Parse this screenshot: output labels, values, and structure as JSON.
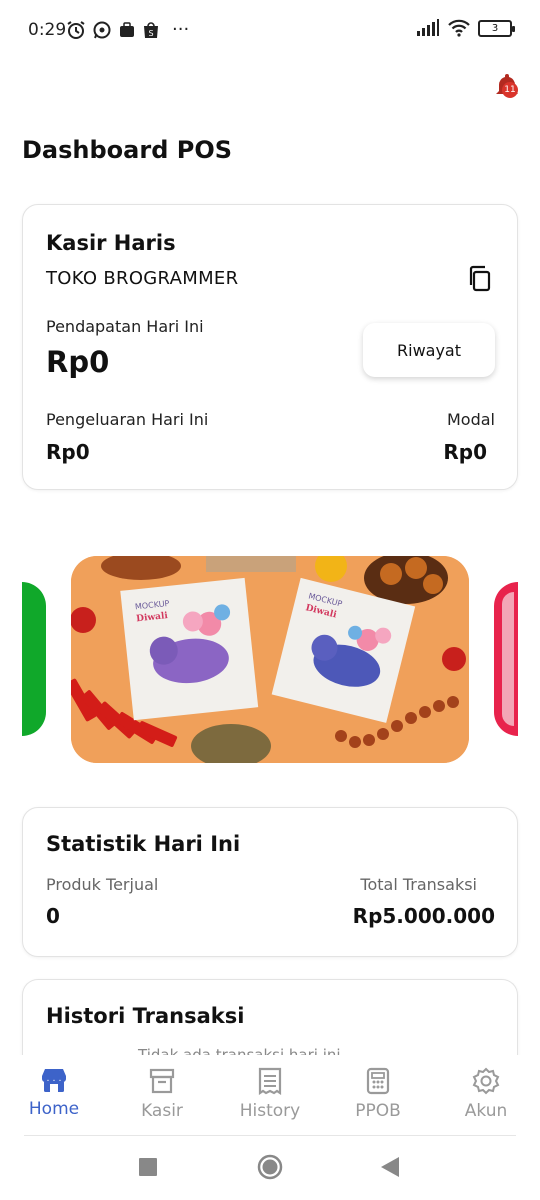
{
  "status_bar": {
    "time": "0:29",
    "left_icons": [
      "alarm-icon",
      "whatsapp-icon",
      "app-icon",
      "shopee-icon",
      "more-icon"
    ],
    "more": "···",
    "right_icons": [
      "signal-icon",
      "wifi-icon",
      "battery-icon"
    ],
    "battery_level": "3"
  },
  "header": {
    "notification_count": "11",
    "title": "Dashboard POS"
  },
  "cashier_card": {
    "name": "Kasir Haris",
    "store": "TOKO BROGRAMMER",
    "income_label": "Pendapatan Hari Ini",
    "income_value": "Rp0",
    "history_button": "Riwayat",
    "expense_label": "Pengeluaran Hari Ini",
    "expense_value": "Rp0",
    "capital_label": "Modal",
    "capital_value": "Rp0"
  },
  "carousel": {
    "mockup_text_1": "MOCKUP",
    "mockup_text_2": "Diwali",
    "colors": {
      "left": "#10a82a",
      "right": "#e8234c",
      "main_bg": "#f0a05a"
    }
  },
  "stats_card": {
    "title": "Statistik Hari Ini",
    "sold_label": "Produk Terjual",
    "sold_value": "0",
    "total_label": "Total Transaksi",
    "total_value": "Rp5.000.000"
  },
  "history_card": {
    "title": "Histori Transaksi",
    "empty_text": "Tidak ada transaksi hari ini"
  },
  "bottom_nav": {
    "items": [
      {
        "label": "Home",
        "icon": "store-icon",
        "active": true
      },
      {
        "label": "Kasir",
        "icon": "archive-icon",
        "active": false
      },
      {
        "label": "History",
        "icon": "receipt-icon",
        "active": false
      },
      {
        "label": "PPOB",
        "icon": "calculator-icon",
        "active": false
      },
      {
        "label": "Akun",
        "icon": "gear-icon",
        "active": false
      }
    ],
    "active_color": "#3d63c9",
    "inactive_color": "#9a9a9a"
  },
  "system_nav": [
    "recents-button",
    "home-button",
    "back-button"
  ]
}
